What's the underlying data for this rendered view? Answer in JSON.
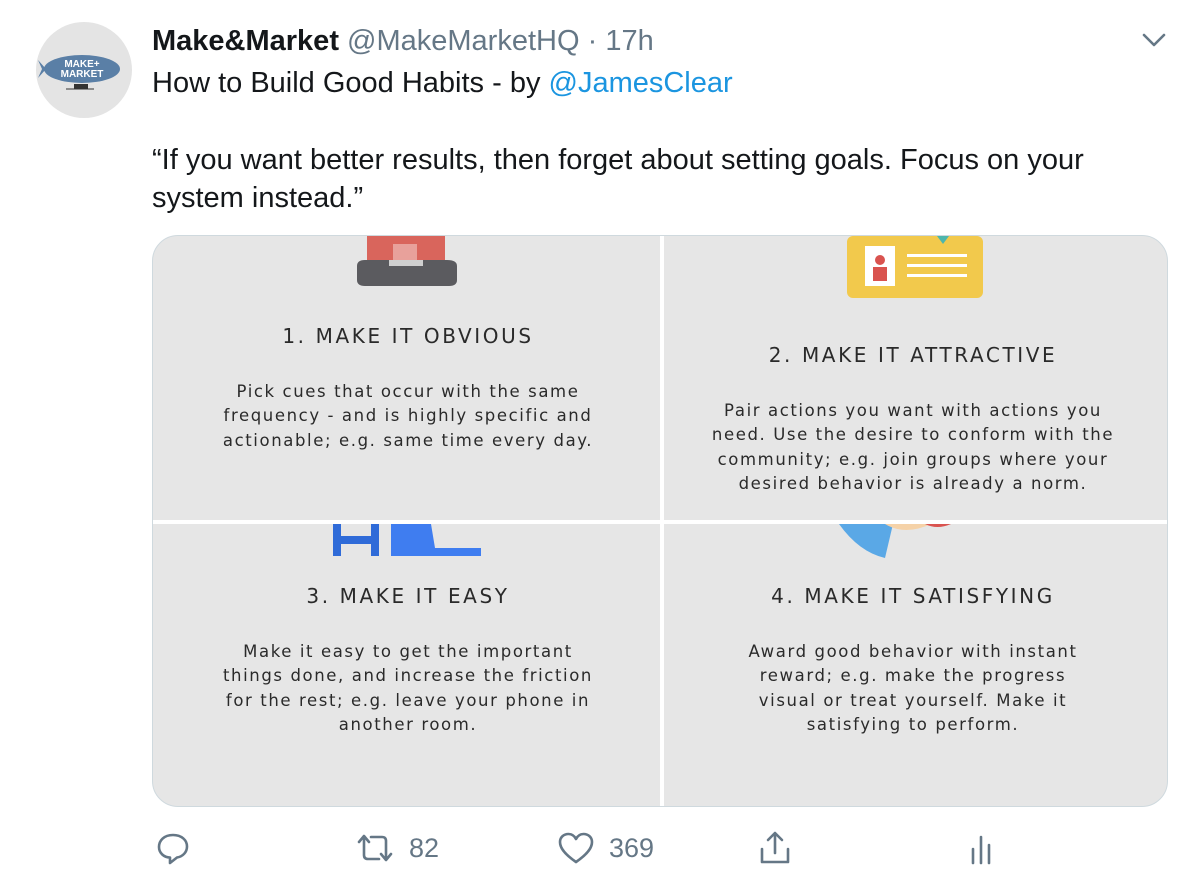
{
  "tweet": {
    "author": {
      "display_name": "Make&Market",
      "handle": "@MakeMarketHQ",
      "separator": "·",
      "time": "17h",
      "avatar_text": [
        "MAKE+",
        "MARKET"
      ]
    },
    "text": {
      "line1_prefix": "How to Build Good Habits - by ",
      "mention": "@JamesClear",
      "quote": "“If you want better results, then forget about setting goals. Focus on your system instead.”"
    },
    "media": {
      "panels": [
        {
          "title": "1. MAKE IT OBVIOUS",
          "body": "Pick cues that occur with the same frequency - and is highly specific and actionable; e.g. same time every day."
        },
        {
          "title": "2. MAKE IT ATTRACTIVE",
          "body": "Pair actions you want with actions you need. Use the desire to conform with the community; e.g. join groups where your desired behavior is already a norm."
        },
        {
          "title": "3. MAKE IT EASY",
          "body": "Make it easy to get the important things done, and increase the friction for the rest; e.g. leave your phone in another room."
        },
        {
          "title": "4. MAKE IT SATISFYING",
          "body": "Award good behavior with instant reward; e.g. make the progress visual or treat yourself. Make it satisfying to perform."
        }
      ]
    },
    "actions": {
      "reply_icon": "reply-icon",
      "retweet_icon": "retweet-icon",
      "retweet_count": "82",
      "like_icon": "heart-icon",
      "like_count": "369",
      "share_icon": "share-icon",
      "analytics_icon": "analytics-icon"
    },
    "colors": {
      "link": "#1b95e0",
      "muted": "#657786",
      "text": "#14171a",
      "media_bg": "#e6e6e6"
    }
  }
}
